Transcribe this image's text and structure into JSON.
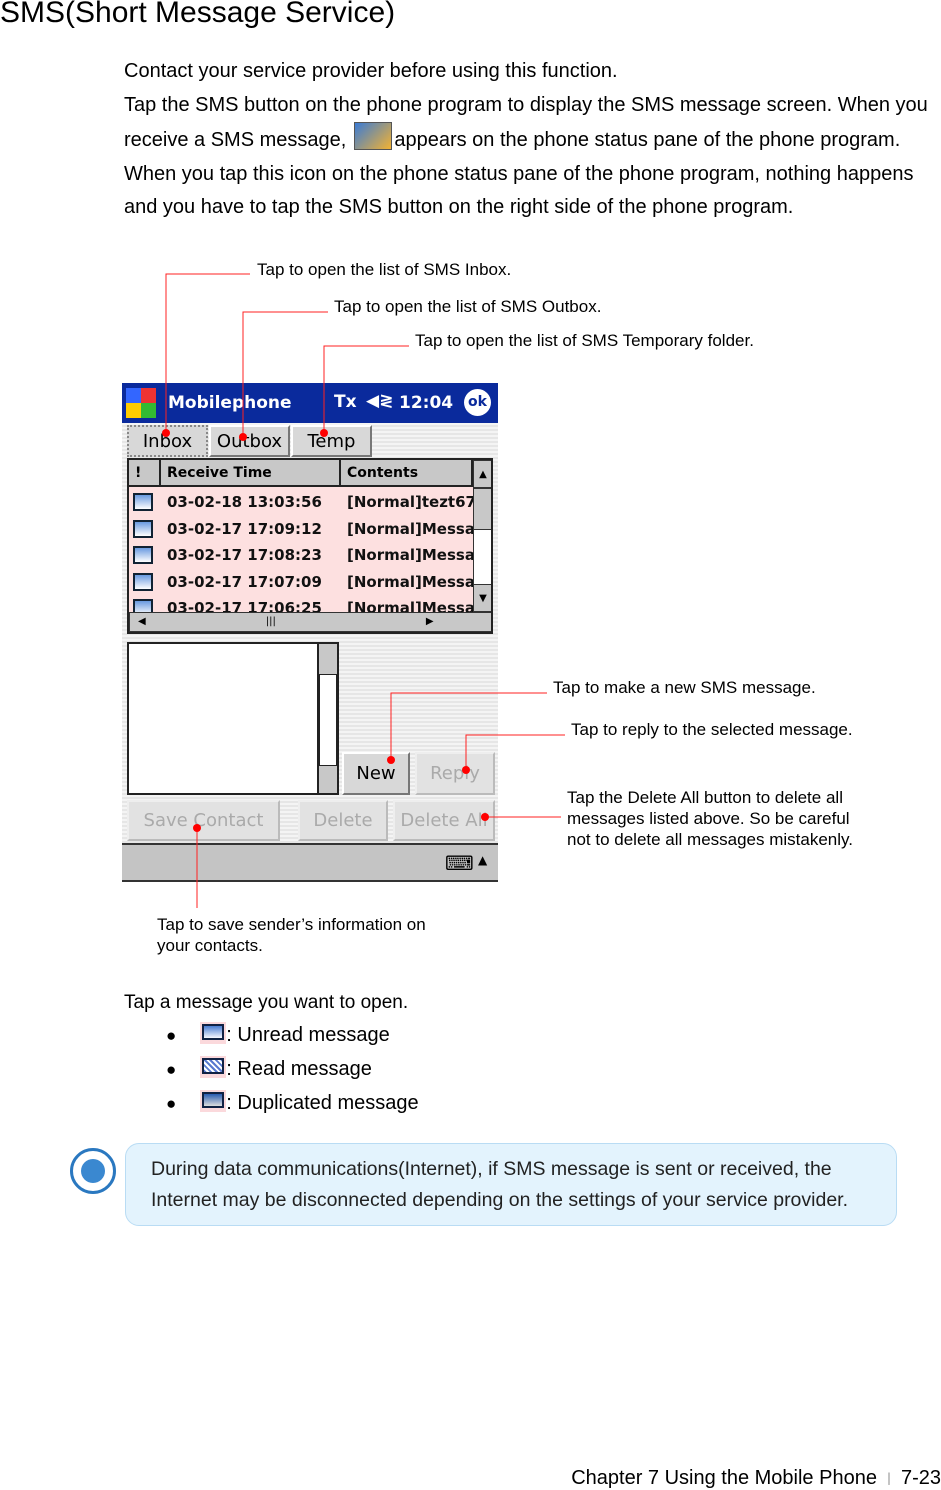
{
  "title": "SMS(Short Message Service)",
  "intro": {
    "p1": "Contact your service provider before using this function.",
    "p2a": "Tap the SMS button on the phone program to display the SMS message screen. When you receive a SMS message,",
    "p2b": "appears on the phone status pane of the phone program. When you tap this icon on the phone status pane of the phone program, nothing happens and you have to tap the SMS button on the right side of the phone program.",
    "status_icon": "sms-envelope-icon"
  },
  "callouts": {
    "inbox": "Tap to open the list of SMS Inbox.",
    "outbox": "Tap to open the list of SMS Outbox.",
    "temp": "Tap to open the list of SMS Temporary folder.",
    "new": "Tap to make a new SMS message.",
    "reply": "Tap to reply to the selected message.",
    "delete_all": "Tap the Delete All button to delete all messages listed above. So be careful not to delete all messages mistakenly.",
    "save_contact": "Tap to save sender’s information on your contacts.",
    "line_color": "#ff0000"
  },
  "phone": {
    "app_title": "Mobilephone",
    "time": "12:04",
    "ok": "ok",
    "signal": "Tx",
    "tabs": [
      "Inbox",
      "Outbox",
      "Temp"
    ],
    "columns": [
      "!",
      "Receive Time",
      "Contents"
    ],
    "rows": [
      {
        "time": "03-02-18 13:03:56",
        "content": "[Normal]tezt67"
      },
      {
        "time": "03-02-17 17:09:12",
        "content": "[Normal]Messa."
      },
      {
        "time": "03-02-17 17:08:23",
        "content": "[Normal]Messa."
      },
      {
        "time": "03-02-17 17:07:09",
        "content": "[Normal]Messa."
      },
      {
        "time": "03-02-17 17:06:25",
        "content": "[Normal]Messa."
      }
    ],
    "buttons": {
      "new": "New",
      "reply": "Reply",
      "save_contact": "Save Contact",
      "delete": "Delete",
      "delete_all": "Delete All"
    },
    "title_bar_color": "#0a2a9c",
    "row_color": "#fde0e0"
  },
  "legend": {
    "heading": "Tap a message you want to open.",
    "items": [
      ": Unread message",
      ": Read message",
      ": Duplicated message"
    ]
  },
  "note": "During data communications(Internet), if SMS message is sent or received, the Internet may be disconnected depending on the settings of your service provider.",
  "footer": {
    "chapter": "Chapter 7 Using the Mobile Phone",
    "sep": "ㅣ",
    "page": "7-23"
  }
}
